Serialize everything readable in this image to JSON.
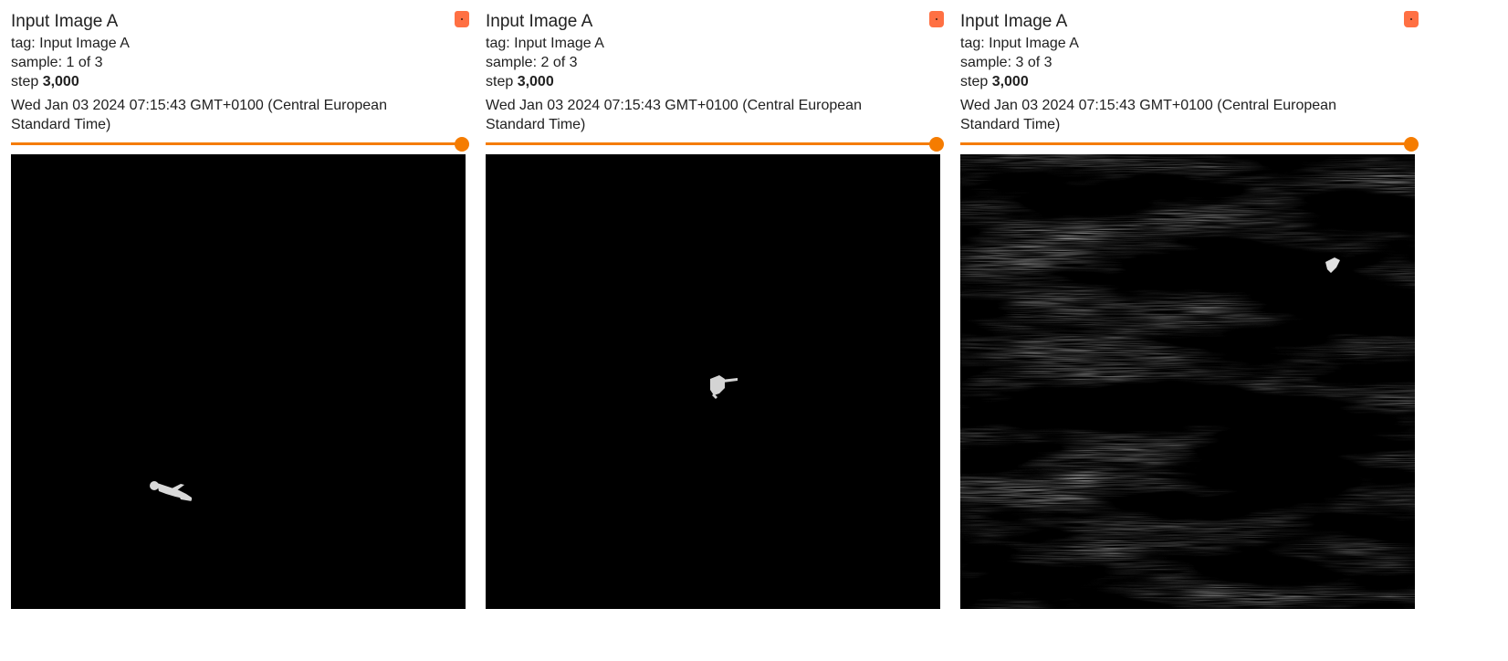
{
  "cards": [
    {
      "title": "Input Image A",
      "tag": "tag: Input Image A",
      "sample": "sample: 1 of 3",
      "step_prefix": "step ",
      "step_value": "3,000",
      "timestamp": "Wed Jan 03 2024 07:15:43 GMT+0100 (Central European Standard Time)",
      "step_slider_position": 1.0
    },
    {
      "title": "Input Image A",
      "tag": "tag: Input Image A",
      "sample": "sample: 2 of 3",
      "step_prefix": "step ",
      "step_value": "3,000",
      "timestamp": "Wed Jan 03 2024 07:15:43 GMT+0100 (Central European Standard Time)",
      "step_slider_position": 1.0
    },
    {
      "title": "Input Image A",
      "tag": "tag: Input Image A",
      "sample": "sample: 3 of 3",
      "step_prefix": "step ",
      "step_value": "3,000",
      "timestamp": "Wed Jan 03 2024 07:15:43 GMT+0100 (Central European Standard Time)",
      "step_slider_position": 1.0
    }
  ],
  "icons": {
    "pin": "pin-icon"
  },
  "colors": {
    "accent": "#f57c00",
    "pin": "#ff7043",
    "image_background": "#000000"
  }
}
